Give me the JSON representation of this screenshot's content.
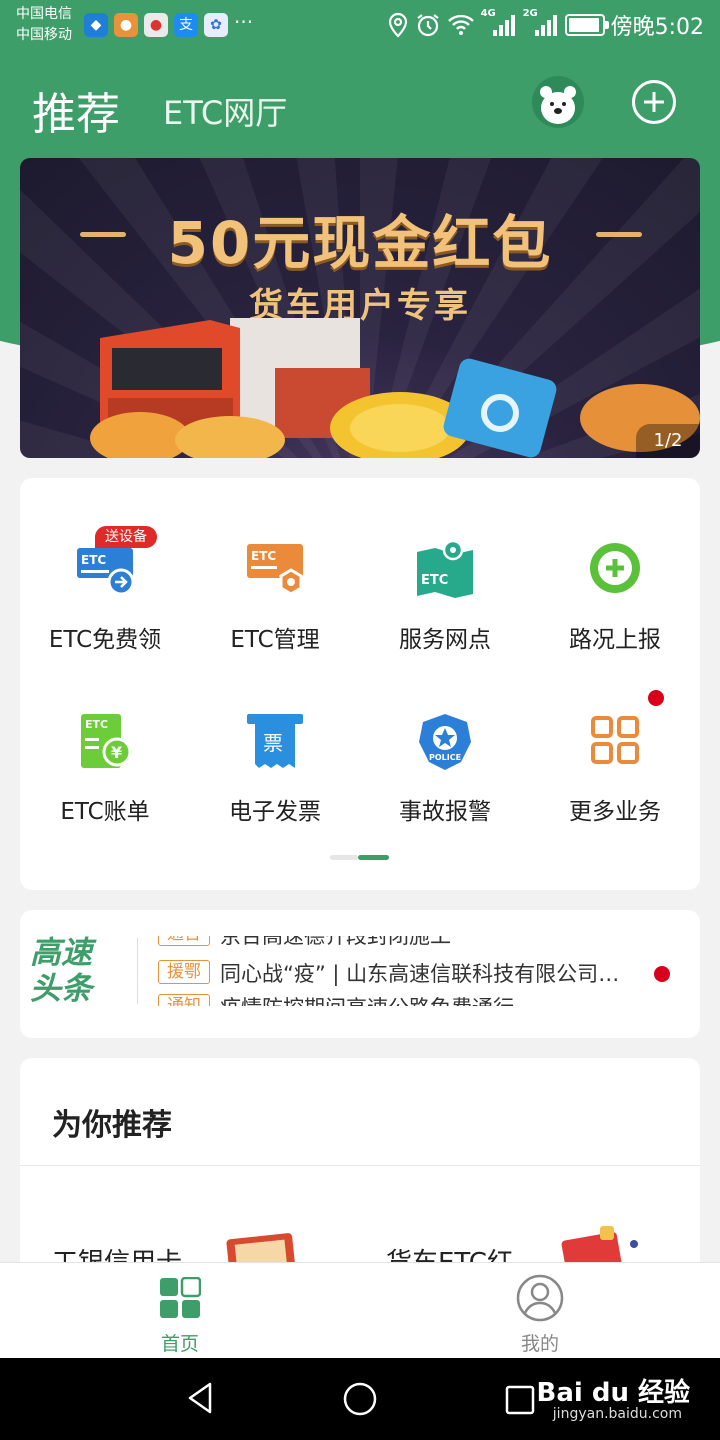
{
  "status_bar": {
    "carrier1": "中国电信",
    "carrier2": "中国移动",
    "more": "···",
    "time": "傍晚5:02",
    "net1": "4G",
    "net2": "2G"
  },
  "header": {
    "title": "推荐",
    "tab": "ETC网厅"
  },
  "banner": {
    "title": "50元现金红包",
    "subtitle": "货车用户专享",
    "page_indicator": "1/2"
  },
  "services": [
    {
      "label": "ETC免费领",
      "badge": "送设备",
      "icon": "etc-card-icon"
    },
    {
      "label": "ETC管理",
      "icon": "etc-settings-icon"
    },
    {
      "label": "服务网点",
      "icon": "map-pin-icon"
    },
    {
      "label": "路况上报",
      "icon": "plus-circle-icon"
    },
    {
      "label": "ETC账单",
      "icon": "bill-icon"
    },
    {
      "label": "电子发票",
      "icon": "invoice-icon"
    },
    {
      "label": "事故报警",
      "icon": "police-badge-icon"
    },
    {
      "label": "更多业务",
      "icon": "grid-icon"
    }
  ],
  "services_icon_text": {
    "etc": "ETC",
    "ticket": "票",
    "police": "POLICE",
    "yen": "¥"
  },
  "news": {
    "logo_line1": "高速",
    "logo_line2": "头条",
    "items": [
      {
        "tag": "通告",
        "text": "京台高速德齐段封闭施工"
      },
      {
        "tag": "援鄂",
        "text": "同心战“疫” | 山东高速信联科技有限公司向湖北捐赠物资"
      },
      {
        "tag": "通知",
        "text": "疫情防控期间高速公路免费通行"
      }
    ]
  },
  "recommend": {
    "title": "为你推荐",
    "items": [
      {
        "label": "工银信用卡"
      },
      {
        "label": "货车ETC红"
      }
    ]
  },
  "tabbar": {
    "home": "首页",
    "mine": "我的"
  },
  "colors": {
    "brand_green": "#3e9e6a",
    "accent_orange": "#e8923a",
    "red_dot": "#d9001b"
  },
  "watermark": {
    "brand": "Bai du 经验",
    "url": "jingyan.baidu.com"
  }
}
